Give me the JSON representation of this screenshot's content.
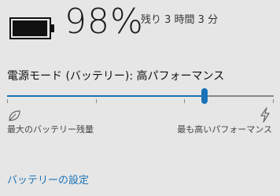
{
  "battery": {
    "percent_text": "98%",
    "level": 0.98,
    "remaining_text": "残り 3 時間 3 分"
  },
  "power_mode": {
    "label": "電源モード (バッテリー): 高パフォーマンス",
    "slider_value": 0.74,
    "slider_steps": 4,
    "left_label": "最大のバッテリー残量",
    "right_label": "最も高いパフォーマンス",
    "left_icon": "leaf-icon",
    "right_icon": "lightning-icon"
  },
  "settings_link": "バッテリーの設定",
  "colors": {
    "accent": "#1a73b8",
    "background": "#e6e6e6",
    "track": "#888888"
  }
}
